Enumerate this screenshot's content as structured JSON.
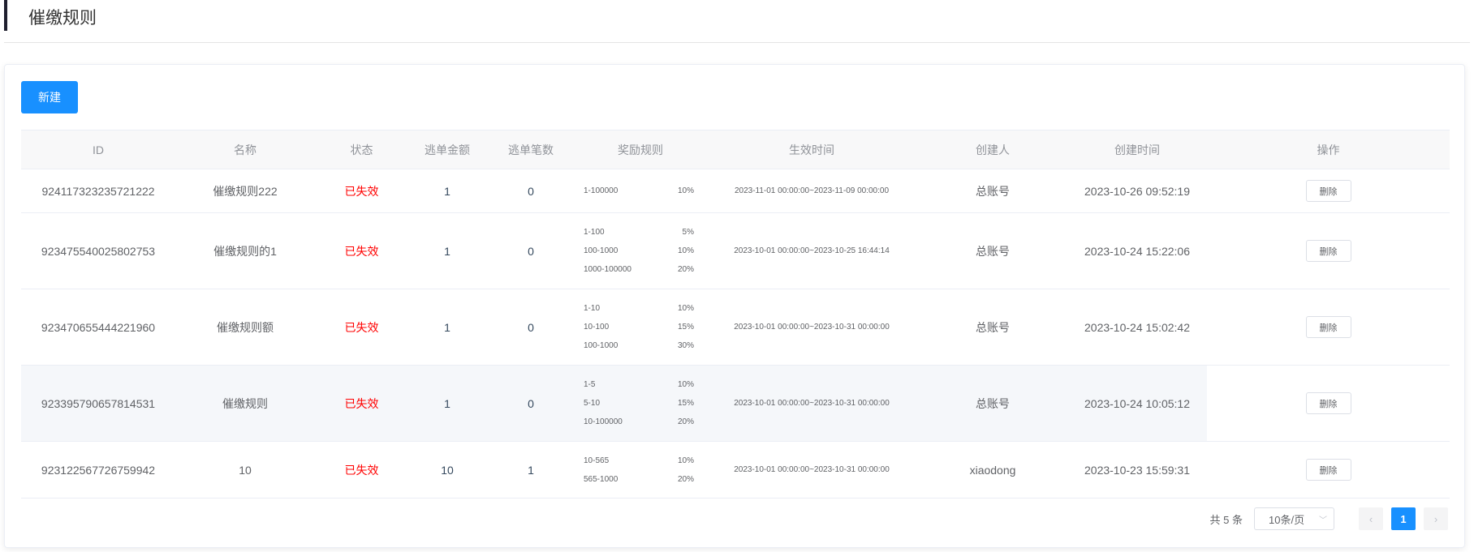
{
  "page": {
    "title": "催缴规则"
  },
  "toolbar": {
    "new_label": "新建"
  },
  "table": {
    "columns": [
      "ID",
      "名称",
      "状态",
      "逃单金额",
      "逃单笔数",
      "奖励规则",
      "生效时间",
      "创建人",
      "创建时间",
      "操作"
    ],
    "rows": [
      {
        "id": "924117323235721222",
        "name": "催缴规则222",
        "status": "已失效",
        "amount": "1",
        "count": "0",
        "rules": [
          {
            "range": "1-100000",
            "rate": "10%"
          }
        ],
        "period": "2023-11-01 00:00:00~2023-11-09 00:00:00",
        "creator": "总账号",
        "created": "2023-10-26 09:52:19",
        "action": "删除"
      },
      {
        "id": "923475540025802753",
        "name": "催缴规则的1",
        "status": "已失效",
        "amount": "1",
        "count": "0",
        "rules": [
          {
            "range": "1-100",
            "rate": "5%"
          },
          {
            "range": "100-1000",
            "rate": "10%"
          },
          {
            "range": "1000-100000",
            "rate": "20%"
          }
        ],
        "period": "2023-10-01 00:00:00~2023-10-25 16:44:14",
        "creator": "总账号",
        "created": "2023-10-24 15:22:06",
        "action": "删除"
      },
      {
        "id": "923470655444221960",
        "name": "催缴规则额",
        "status": "已失效",
        "amount": "1",
        "count": "0",
        "rules": [
          {
            "range": "1-10",
            "rate": "10%"
          },
          {
            "range": "10-100",
            "rate": "15%"
          },
          {
            "range": "100-1000",
            "rate": "30%"
          }
        ],
        "period": "2023-10-01 00:00:00~2023-10-31 00:00:00",
        "creator": "总账号",
        "created": "2023-10-24 15:02:42",
        "action": "删除"
      },
      {
        "id": "923395790657814531",
        "name": "催缴规则",
        "status": "已失效",
        "amount": "1",
        "count": "0",
        "rules": [
          {
            "range": "1-5",
            "rate": "10%"
          },
          {
            "range": "5-10",
            "rate": "15%"
          },
          {
            "range": "10-100000",
            "rate": "20%"
          }
        ],
        "period": "2023-10-01 00:00:00~2023-10-31 00:00:00",
        "creator": "总账号",
        "created": "2023-10-24 10:05:12",
        "action": "删除"
      },
      {
        "id": "923122567726759942",
        "name": "10",
        "status": "已失效",
        "amount": "10",
        "count": "1",
        "rules": [
          {
            "range": "10-565",
            "rate": "10%"
          },
          {
            "range": "565-1000",
            "rate": "20%"
          }
        ],
        "period": "2023-10-01 00:00:00~2023-10-31 00:00:00",
        "creator": "xiaodong",
        "created": "2023-10-23 15:59:31",
        "action": "删除"
      }
    ]
  },
  "pagination": {
    "total": "共 5 条",
    "page_size": "10条/页",
    "current": "1",
    "prev": "‹",
    "next": "›"
  }
}
